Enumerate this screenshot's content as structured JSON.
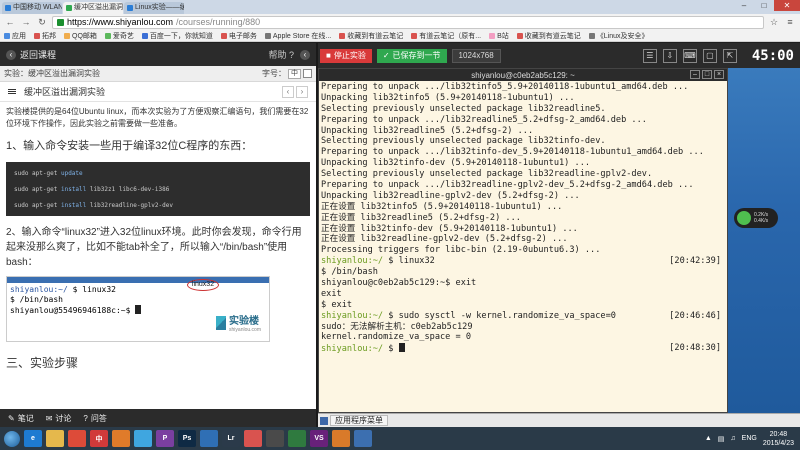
{
  "browser": {
    "tabs": [
      {
        "label": "中国移动 WLAN",
        "color": "#2a7dd6"
      },
      {
        "label": "缓冲区溢出漏洞实验 - 实",
        "color": "#2fa84f"
      },
      {
        "label": "Linux实验——缓冲区溢出",
        "color": "#2a7dd6"
      }
    ],
    "url_host": "https://www.shiyanlou.com",
    "url_path": "/courses/running/880",
    "bookmarks": [
      {
        "label": "应用",
        "color": "#4a8be0"
      },
      {
        "label": "拓邦",
        "color": "#d9534f"
      },
      {
        "label": "QQ邮箱",
        "color": "#f0ad4e"
      },
      {
        "label": "爱奇艺",
        "color": "#5cb85c"
      },
      {
        "label": "百度一下，你就知道",
        "color": "#3b6fd6"
      },
      {
        "label": "电子邮务",
        "color": "#d9534f"
      },
      {
        "label": "Apple Store 在线...",
        "color": "#777777"
      },
      {
        "label": "收藏到有道云笔记",
        "color": "#d9534f"
      },
      {
        "label": "有道云笔记（原有...",
        "color": "#d9534f"
      },
      {
        "label": "B站",
        "color": "#f39ec2"
      },
      {
        "label": "收藏到有道云笔记",
        "color": "#d9534f"
      },
      {
        "label": "《Linux及安全》",
        "color": "#777777"
      }
    ]
  },
  "left": {
    "back_label": "返回课程",
    "help_label": "帮助 ?",
    "crumb": "实验：缓冲区溢出漏洞实验",
    "font_label": "字号：",
    "font_value": "中",
    "doc_title": "缓冲区溢出漏洞实验",
    "intro": "实验楼提供的是64位Ubuntu linux，而本次实验为了方便观察汇编语句，我们需要在32位环境下作操作，因此实验之前需要做一些准备。",
    "step1": "1、输入命令安装一些用于编译32位C程序的东西：",
    "code": [
      {
        "cmd": "sudo apt-get ",
        "kw": "update",
        "rest": ""
      },
      {
        "cmd": "sudo apt-get ",
        "kw": "install",
        "rest": " lib32z1 libc6-dev-i386"
      },
      {
        "cmd": "sudo apt-get ",
        "kw": "install",
        "rest": " lib32readline-gplv2-dev"
      }
    ],
    "step2": "2、输入命令“linux32”进入32位linux环境。此时你会发现，命令行用起来没那么爽了，比如不能tab补全了，所以输入“/bin/bash”使用bash：",
    "shot": {
      "tag": "linux32",
      "line1_user": "shiyanlou:~/",
      "line1_cmd": " $ linux32",
      "line2": "$ /bin/bash",
      "line3": "shiyanlou@55496946188c:~$",
      "logo": "实验楼",
      "logo_sub": "shiyanlou.com"
    },
    "section3": "三、实验步骤",
    "footer": {
      "notes": "笔记",
      "discuss": "讨论",
      "qa": "问答"
    }
  },
  "toolbar": {
    "stop": "停止实验",
    "save": "已保存到一节",
    "resolution": "1024x768",
    "timer": "45:00"
  },
  "terminal": {
    "title": "shiyanlou@c0eb2ab5c129: ~",
    "lines": [
      {
        "text": "Preparing to unpack .../lib32tinfo5_5.9+20140118-1ubuntu1_amd64.deb ..."
      },
      {
        "text": "Unpacking lib32tinfo5 (5.9+20140118-1ubuntu1) ..."
      },
      {
        "text": "Selecting previously unselected package lib32readline5."
      },
      {
        "text": "Preparing to unpack .../lib32readline5_5.2+dfsg-2_amd64.deb ..."
      },
      {
        "text": "Unpacking lib32readline5 (5.2+dfsg-2) ..."
      },
      {
        "text": "Selecting previously unselected package lib32tinfo-dev."
      },
      {
        "text": "Preparing to unpack .../lib32tinfo-dev_5.9+20140118-1ubuntu1_amd64.deb ..."
      },
      {
        "text": "Unpacking lib32tinfo-dev (5.9+20140118-1ubuntu1) ..."
      },
      {
        "text": "Selecting previously unselected package lib32readline-gplv2-dev."
      },
      {
        "text": "Preparing to unpack .../lib32readline-gplv2-dev_5.2+dfsg-2_amd64.deb ..."
      },
      {
        "text": "Unpacking lib32readline-gplv2-dev (5.2+dfsg-2) ..."
      },
      {
        "text": "正在设置 lib32tinfo5 (5.9+20140118-1ubuntu1) ..."
      },
      {
        "text": "正在设置 lib32readline5 (5.2+dfsg-2) ..."
      },
      {
        "text": "正在设置 lib32tinfo-dev (5.9+20140118-1ubuntu1) ..."
      },
      {
        "text": "正在设置 lib32readline-gplv2-dev (5.2+dfsg-2) ..."
      },
      {
        "text": "Processing triggers for libc-bin (2.19-0ubuntu6.3) ..."
      },
      {
        "user": "shiyanlou:~/",
        "text": " $ linux32",
        "ts": "[20:42:39]"
      },
      {
        "text": "$ /bin/bash"
      },
      {
        "text": "shiyanlou@c0eb2ab5c129:~$ exit"
      },
      {
        "text": "exit"
      },
      {
        "text": "$ exit"
      },
      {
        "user": "shiyanlou:~/",
        "text": " $ sudo sysctl -w kernel.randomize_va_space=0",
        "ts": "[20:46:46]"
      },
      {
        "text": "sudo：无法解析主机：c0eb2ab5c129"
      },
      {
        "text": "kernel.randomize_va_space = 0"
      },
      {
        "user": "shiyanlou:~/",
        "text": " $ ",
        "ts": "[20:48:30]",
        "cursor": true
      }
    ]
  },
  "netwidget": {
    "up": "0.2K/s",
    "down": "0.4K/s"
  },
  "desktop_task": {
    "menu": "应用程序菜单"
  },
  "taskbar": {
    "icons": [
      {
        "name": "ie-icon",
        "label": "e",
        "color": "#1e7bd1"
      },
      {
        "name": "explorer-icon",
        "label": "",
        "color": "#e5b84c"
      },
      {
        "name": "chrome-icon",
        "label": "",
        "color": "#dd4b39"
      },
      {
        "name": "cmcc-icon",
        "label": "中",
        "color": "#d13a3a"
      },
      {
        "name": "cmcc-app-icon",
        "label": "",
        "color": "#e07b2a"
      },
      {
        "name": "qq-icon",
        "label": "",
        "color": "#3fa6e0"
      },
      {
        "name": "p-app-icon",
        "label": "P",
        "color": "#7a3fa0"
      },
      {
        "name": "photoshop-icon",
        "label": "Ps",
        "color": "#0f2a44"
      },
      {
        "name": "app-icon",
        "label": "",
        "color": "#2f6fb5"
      },
      {
        "name": "lightroom-icon",
        "label": "Lr",
        "color": "#2b3a4a"
      },
      {
        "name": "xmind-icon",
        "label": "",
        "color": "#d9534f"
      },
      {
        "name": "app2-icon",
        "label": "",
        "color": "#4a4a4a"
      },
      {
        "name": "app3-icon",
        "label": "",
        "color": "#2f7a3f"
      },
      {
        "name": "visual-studio-icon",
        "label": "VS",
        "color": "#68217a"
      },
      {
        "name": "app4-icon",
        "label": "",
        "color": "#d97a2a"
      },
      {
        "name": "app5-icon",
        "label": "",
        "color": "#3c6fb0"
      }
    ],
    "lang": "ENG",
    "time": "20:48",
    "date": "2015/4/23"
  }
}
